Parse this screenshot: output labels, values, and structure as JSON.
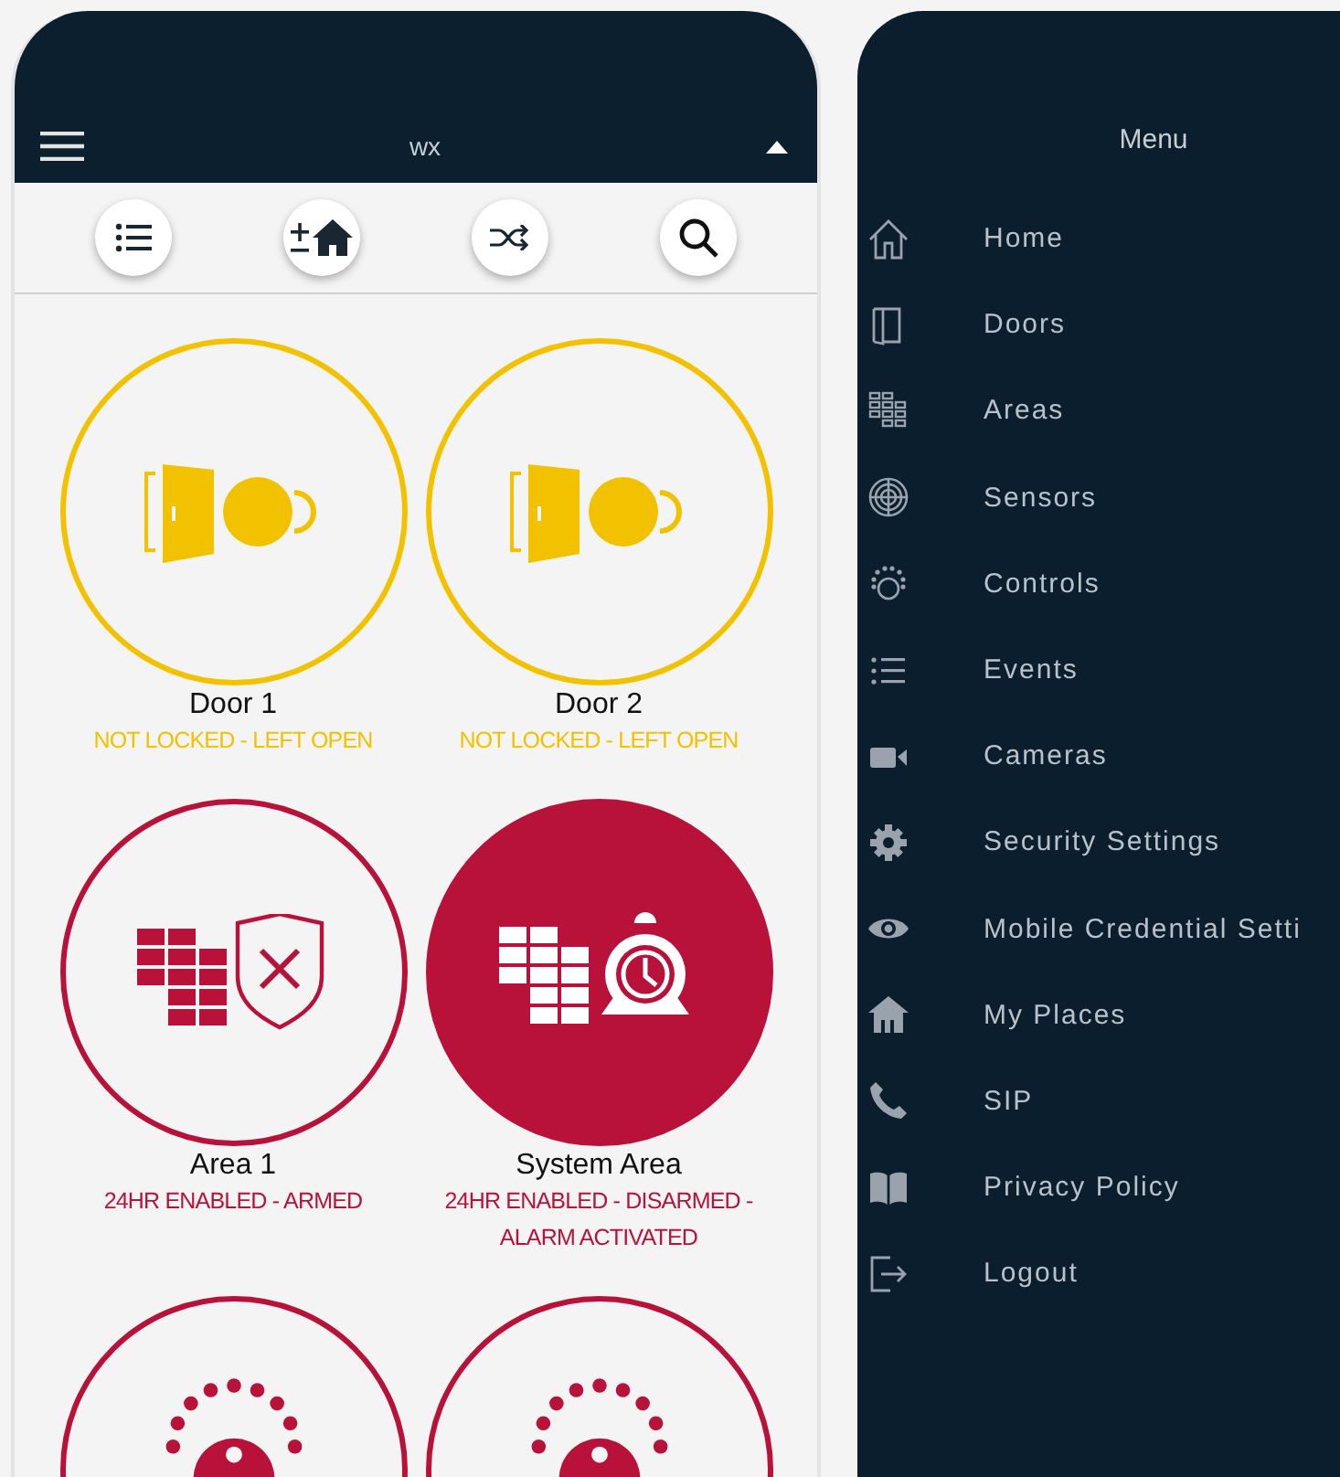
{
  "app_bar": {
    "title": "wx"
  },
  "toolbar": [
    {
      "kind": "list"
    },
    {
      "kind": "add-home"
    },
    {
      "kind": "shuffle"
    },
    {
      "kind": "search"
    }
  ],
  "tiles": [
    {
      "kind": "door",
      "color": "#f2c200",
      "filled": false,
      "name": "Door 1",
      "state": "NOT LOCKED - LEFT OPEN"
    },
    {
      "kind": "door",
      "color": "#f2c200",
      "filled": false,
      "name": "Door 2",
      "state": "NOT LOCKED - LEFT OPEN"
    },
    {
      "kind": "area-armed",
      "color": "#b8123a",
      "filled": false,
      "name": "Area 1",
      "state": "24HR ENABLED - ARMED"
    },
    {
      "kind": "area-alarm",
      "color": "#b8123a",
      "filled": true,
      "name": "System Area",
      "state": "24HR ENABLED - DISARMED - ALARM ACTIVATED"
    },
    {
      "kind": "control",
      "color": "#b8123a",
      "filled": false
    },
    {
      "kind": "control",
      "color": "#b8123a",
      "filled": false
    }
  ],
  "menu": {
    "title": "Menu",
    "items": [
      {
        "kind": "home",
        "label": "Home"
      },
      {
        "kind": "doors",
        "label": "Doors"
      },
      {
        "kind": "areas",
        "label": "Areas"
      },
      {
        "kind": "sensors",
        "label": "Sensors"
      },
      {
        "kind": "controls",
        "label": "Controls"
      },
      {
        "kind": "events",
        "label": "Events"
      },
      {
        "kind": "cameras",
        "label": "Cameras"
      },
      {
        "kind": "settings",
        "label": "Security Settings"
      },
      {
        "kind": "eye",
        "label": "Mobile Credential Setti"
      },
      {
        "kind": "places",
        "label": "My Places"
      },
      {
        "kind": "phone",
        "label": "SIP"
      },
      {
        "kind": "book",
        "label": "Privacy Policy"
      },
      {
        "kind": "logout",
        "label": "Logout"
      }
    ]
  }
}
